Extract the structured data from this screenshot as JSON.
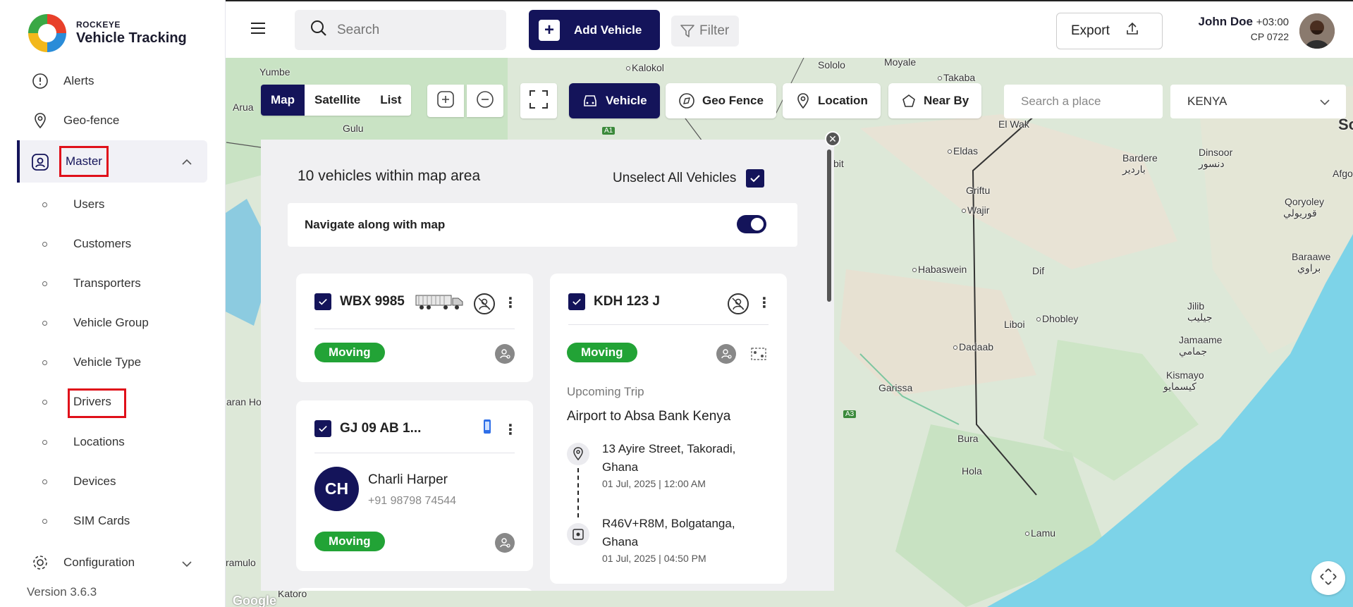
{
  "brand": {
    "small": "ROCKEYE",
    "name": "Vehicle Tracking"
  },
  "sidebar": {
    "items": [
      {
        "label": "Alerts",
        "icon": "alert-icon"
      },
      {
        "label": "Geo-fence",
        "icon": "geofence-pin-icon"
      },
      {
        "label": "Master",
        "icon": "user-badge-icon",
        "expanded": true
      }
    ],
    "sub_items": [
      "Users",
      "Customers",
      "Transporters",
      "Vehicle Group",
      "Vehicle Type",
      "Drivers",
      "Locations",
      "Devices",
      "SIM Cards"
    ],
    "config_label": "Configuration",
    "version": "Version 3.6.3"
  },
  "header": {
    "search_placeholder": "Search",
    "add_label": "Add Vehicle",
    "filter_label": "Filter",
    "export_label": "Export",
    "user_name": "John Doe",
    "user_tz": "+03:00",
    "user_cp": "CP 0722"
  },
  "map_controls": {
    "view_tabs": [
      "Map",
      "Satellite",
      "List"
    ],
    "active_view": "Map",
    "chips": [
      "Vehicle",
      "Geo Fence",
      "Location",
      "Near By"
    ],
    "active_chip": "Vehicle",
    "place_placeholder": "Search a place",
    "country": "KENYA"
  },
  "map_places": [
    {
      "name": "Yumbe"
    },
    {
      "name": "Kalokol"
    },
    {
      "name": "Sololo"
    },
    {
      "name": "Moyale"
    },
    {
      "name": "Takaba"
    },
    {
      "name": "Arua"
    },
    {
      "name": "Gulu"
    },
    {
      "name": "El Wak"
    },
    {
      "name": "Eldas"
    },
    {
      "name": "Bardere"
    },
    {
      "name": "باردير"
    },
    {
      "name": "Dinsoor"
    },
    {
      "name": "دنسور"
    },
    {
      "name": "Griftu"
    },
    {
      "name": "Wajir"
    },
    {
      "name": "Qoryoley"
    },
    {
      "name": "قوريولي"
    },
    {
      "name": "Habaswein"
    },
    {
      "name": "Dif"
    },
    {
      "name": "Baraawe"
    },
    {
      "name": "براوي"
    },
    {
      "name": "Liboi"
    },
    {
      "name": "Dhobley"
    },
    {
      "name": "Jilib"
    },
    {
      "name": "جيليب"
    },
    {
      "name": "Dadaab"
    },
    {
      "name": "Jamaame"
    },
    {
      "name": "جمامي"
    },
    {
      "name": "Kismayo"
    },
    {
      "name": "كيسمايو"
    },
    {
      "name": "Garissa"
    },
    {
      "name": "Bura"
    },
    {
      "name": "Hola"
    },
    {
      "name": "Lamu"
    },
    {
      "name": "Jaran Hoa"
    },
    {
      "name": "ramulo"
    },
    {
      "name": "Katoro"
    },
    {
      "name": "bit"
    },
    {
      "name": "Afgo"
    },
    {
      "name": "So"
    }
  ],
  "road_badges": [
    "A1",
    "A3"
  ],
  "panel": {
    "title": "10 vehicles within map area",
    "unselect_label": "Unselect All Vehicles",
    "navigate_label": "Navigate along with map",
    "navigate_on": true,
    "vehicles": [
      {
        "plate": "WBX 9985",
        "status": "Moving"
      },
      {
        "plate": "GJ 09 AB 1...",
        "status": "Moving",
        "driver_initials": "CH",
        "driver_name": "Charli Harper",
        "driver_phone": "+91 98798 74544"
      },
      {
        "plate": "KDH 123 J",
        "status": "Moving",
        "trip_label": "Upcoming Trip",
        "trip_route": "Airport to Absa Bank Kenya",
        "stops": [
          {
            "address": "13 Ayire Street, Takoradi, Ghana",
            "time": "01 Jul, 2025 | 12:00 AM"
          },
          {
            "address": "R46V+R8M, Bolgatanga, Ghana",
            "time": "01 Jul, 2025 | 04:50 PM"
          }
        ]
      }
    ]
  },
  "footer": {
    "google": "Google"
  },
  "colors": {
    "primary": "#14145a",
    "moving": "#22a336",
    "highlight": "#e0101a",
    "sea": "#7dd3e8"
  }
}
